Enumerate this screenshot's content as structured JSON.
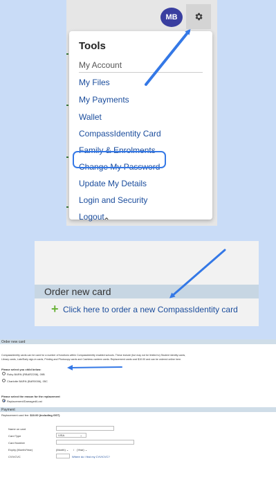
{
  "colors": {
    "accent": "#3478e6",
    "avatar": "#3a3fa0",
    "link": "#1a4c9c",
    "plus": "#6bb33a",
    "page_bg": "#c9dcf7"
  },
  "header": {
    "avatar_initials": "MB",
    "settings_icon": "gear-icon"
  },
  "menu": {
    "title": "Tools",
    "section": "My Account",
    "items": [
      "My Files",
      "My Payments",
      "Wallet",
      "CompassIdentity Card",
      "Family & Enrolments",
      "Change My Password",
      "Update My Details",
      "Login and Security",
      "Logout"
    ],
    "highlighted": "CompassIdentity Card"
  },
  "order_zoom": {
    "heading": "Order new card",
    "link": "Click here to order a new CompassIdentity card",
    "plus_icon": "plus-icon"
  },
  "form": {
    "heading": "Order new card",
    "description_1": "CompassIdentity cards can be used for a number of functions within CompassIdentity enabled schools. These include (but may not be limited to) Student identity cards,",
    "description_2": "Library cards, Late/Early sign-in cards, Printing and Photocopy cards and Cashless canteen cards. Replacement cards cost $10.00 and can be ordered online here.",
    "child_label": "Please select you child below:",
    "children": [
      "Ruby BARN (RBAR2208), 09B",
      "Charlotte BARN (BAR0006), 05C"
    ],
    "reason_label": "Please select the reason for the replacement",
    "reason": "Replacement/Damaged/Lost",
    "payment_heading": "Payment",
    "fee_prefix": "Replacement card fee: ",
    "fee_value": "$10.00 (including GST)",
    "fields": {
      "name_label": "Name on card",
      "type_label": "Card Type",
      "type_value": "VISA",
      "number_label": "Card Number",
      "expiry_label": "Expiry (Month/Year)",
      "month": "(Month)",
      "year": "(Year)",
      "slash": "/",
      "cvv_label": "CVV/CVC",
      "cvv_help": "Where do I find my CVV/CVC?"
    }
  }
}
